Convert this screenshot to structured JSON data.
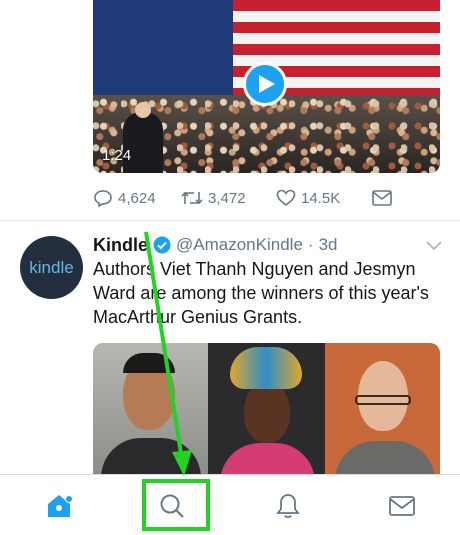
{
  "tweet_1": {
    "video": {
      "duration": "1:24"
    },
    "actions": {
      "replies": "4,624",
      "retweets": "3,472",
      "likes": "14.5K"
    }
  },
  "tweet_2": {
    "avatar_text": "kindle",
    "name": "Kindle",
    "handle": "@AmazonKindle",
    "separator": "·",
    "time": "3d",
    "text": "Authors Viet Thanh Nguyen and Jesmyn Ward are among the winners of this year's MacArthur Genius Grants."
  },
  "tabbar": {
    "items": [
      {
        "name": "home",
        "icon": "home-icon"
      },
      {
        "name": "search",
        "icon": "search-icon"
      },
      {
        "name": "notifications",
        "icon": "bell-icon"
      },
      {
        "name": "messages",
        "icon": "envelope-icon"
      }
    ]
  },
  "colors": {
    "accent": "#1da1f2",
    "text": "#14171a",
    "secondary": "#657786",
    "annotation": "#21d423"
  }
}
